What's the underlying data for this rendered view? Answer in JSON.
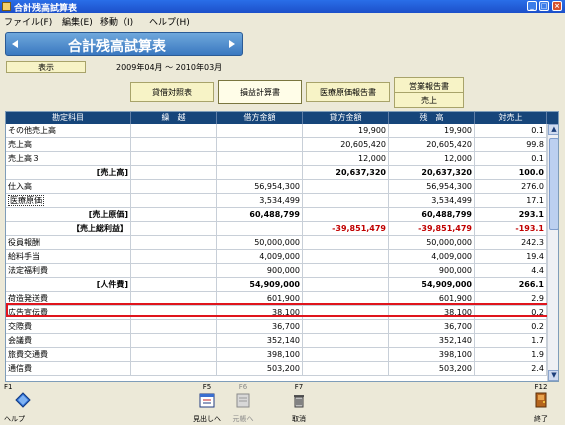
{
  "window": {
    "title": "合計残高試算表"
  },
  "menu": [
    "ファイル(F)",
    "編集(E)",
    "移動（I)",
    "ヘルプ(H)"
  ],
  "report_title": "合計残高試算表",
  "display_button": "表示",
  "period": "2009年04月 ～ 2010年03月",
  "tabs": {
    "bs": "貸借対照表",
    "pl": "損益計算書",
    "cost": "医療原価報告書",
    "sales_top": "営業報告書",
    "sales_bottom": "売上"
  },
  "columns": [
    "勘定科目",
    "繰　越",
    "借方金額",
    "貸方金額",
    "残　高",
    "対売上"
  ],
  "rows": [
    {
      "label": "その他売上高",
      "carry": "",
      "debit": "",
      "credit": "19,900",
      "balance": "19,900",
      "ratio": "0.1"
    },
    {
      "label": "売上高",
      "carry": "",
      "debit": "",
      "credit": "20,605,420",
      "balance": "20,605,420",
      "ratio": "99.8"
    },
    {
      "label": "売上高３",
      "carry": "",
      "debit": "",
      "credit": "12,000",
      "balance": "12,000",
      "ratio": "0.1"
    },
    {
      "label": "[売上高]",
      "carry": "",
      "debit": "",
      "credit": "20,637,320",
      "balance": "20,637,320",
      "ratio": "100.0"
    },
    {
      "label": "仕入高",
      "carry": "",
      "debit": "56,954,300",
      "credit": "",
      "balance": "56,954,300",
      "ratio": "276.0"
    },
    {
      "label": "医療原価",
      "carry": "",
      "debit": "3,534,499",
      "credit": "",
      "balance": "3,534,499",
      "ratio": "17.1"
    },
    {
      "label": "[売上原価]",
      "carry": "",
      "debit": "60,488,799",
      "credit": "",
      "balance": "60,488,799",
      "ratio": "293.1"
    },
    {
      "label": "【売上総利益】",
      "carry": "",
      "debit": "",
      "credit": "-39,851,479",
      "balance": "-39,851,479",
      "ratio": "-193.1"
    },
    {
      "label": "役員報酬",
      "carry": "",
      "debit": "50,000,000",
      "credit": "",
      "balance": "50,000,000",
      "ratio": "242.3"
    },
    {
      "label": "給料手当",
      "carry": "",
      "debit": "4,009,000",
      "credit": "",
      "balance": "4,009,000",
      "ratio": "19.4"
    },
    {
      "label": "法定福利費",
      "carry": "",
      "debit": "900,000",
      "credit": "",
      "balance": "900,000",
      "ratio": "4.4"
    },
    {
      "label": "[人件費]",
      "carry": "",
      "debit": "54,909,000",
      "credit": "",
      "balance": "54,909,000",
      "ratio": "266.1"
    },
    {
      "label": "荷造発送費",
      "carry": "",
      "debit": "601,900",
      "credit": "",
      "balance": "601,900",
      "ratio": "2.9"
    },
    {
      "label": "広告宣伝費",
      "carry": "",
      "debit": "38,100",
      "credit": "",
      "balance": "38,100",
      "ratio": "0.2"
    },
    {
      "label": "交際費",
      "carry": "",
      "debit": "36,700",
      "credit": "",
      "balance": "36,700",
      "ratio": "0.2"
    },
    {
      "label": "会議費",
      "carry": "",
      "debit": "352,140",
      "credit": "",
      "balance": "352,140",
      "ratio": "1.7"
    },
    {
      "label": "旅費交通費",
      "carry": "",
      "debit": "398,100",
      "credit": "",
      "balance": "398,100",
      "ratio": "1.9"
    },
    {
      "label": "通信費",
      "carry": "",
      "debit": "503,200",
      "credit": "",
      "balance": "503,200",
      "ratio": "2.4"
    }
  ],
  "fkeys": [
    {
      "key": "F1",
      "label": "ヘルプ",
      "icon": "help-diamond-icon"
    },
    {
      "key": "F5",
      "label": "見出しへ",
      "icon": "heading-calendar-icon"
    },
    {
      "key": "F6",
      "label": "元帳へ",
      "icon": "ledger-icon"
    },
    {
      "key": "F7",
      "label": "取消",
      "icon": "trash-icon"
    },
    {
      "key": "F12",
      "label": "終了",
      "icon": "exit-door-icon"
    }
  ],
  "colors": {
    "header_bg": "#16457a",
    "negative": "#c00000",
    "selection": "#e0141c"
  }
}
